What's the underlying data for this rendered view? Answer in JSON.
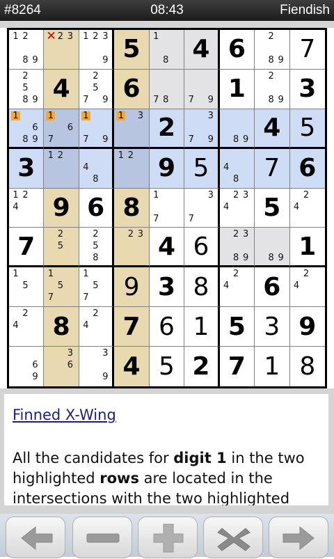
{
  "status_bar": {
    "puzzle_id": "#8264",
    "time": "08:43",
    "difficulty": "Fiendish"
  },
  "grid": [
    [
      {
        "c": [
          "1",
          "2",
          "8",
          "9"
        ]
      },
      {
        "c": [
          "1",
          "2",
          "3"
        ],
        "x": "1"
      },
      {
        "c": [
          "1",
          "2",
          "3",
          "9"
        ]
      },
      {
        "v": "5",
        "g": true
      },
      {
        "c": [
          "1",
          "8"
        ]
      },
      {
        "v": "4",
        "g": true
      },
      {
        "v": "6",
        "g": true
      },
      {
        "c": [
          "2",
          "8",
          "9"
        ]
      },
      {
        "v": "7",
        "g": false
      }
    ],
    [
      {
        "c": [
          "2",
          "5",
          "8",
          "9"
        ]
      },
      {
        "v": "4",
        "g": true
      },
      {
        "c": [
          "2",
          "5",
          "7",
          "9"
        ]
      },
      {
        "v": "6",
        "g": true
      },
      {
        "c": [
          "7",
          "8"
        ]
      },
      {
        "c": [
          "7",
          "9"
        ]
      },
      {
        "v": "1",
        "g": true
      },
      {
        "c": [
          "2",
          "8",
          "9"
        ]
      },
      {
        "v": "3",
        "g": true
      }
    ],
    [
      {
        "c": [
          "1",
          "6",
          "8",
          "9"
        ],
        "h": "1"
      },
      {
        "c": [
          "1",
          "6",
          "7"
        ],
        "h": "1"
      },
      {
        "c": [
          "1",
          "7",
          "9"
        ],
        "h": "1"
      },
      {
        "c": [
          "1",
          "3"
        ],
        "h": "1"
      },
      {
        "v": "2",
        "g": true
      },
      {
        "c": [
          "3",
          "7",
          "9"
        ]
      },
      {
        "c": [
          "8",
          "9"
        ]
      },
      {
        "v": "4",
        "g": true
      },
      {
        "v": "5",
        "g": false
      }
    ],
    [
      {
        "v": "3",
        "g": true
      },
      {
        "c": [
          "1",
          "2"
        ]
      },
      {
        "c": [
          "4",
          "8"
        ]
      },
      {
        "c": [
          "1",
          "2"
        ]
      },
      {
        "v": "9",
        "g": true
      },
      {
        "v": "5",
        "g": false
      },
      {
        "c": [
          "4",
          "8"
        ]
      },
      {
        "v": "7",
        "g": false
      },
      {
        "v": "6",
        "g": true
      }
    ],
    [
      {
        "c": [
          "1",
          "2",
          "4"
        ]
      },
      {
        "v": "9",
        "g": true
      },
      {
        "v": "6",
        "g": true
      },
      {
        "v": "8",
        "g": true
      },
      {
        "c": [
          "1",
          "7"
        ]
      },
      {
        "c": [
          "3",
          "7"
        ]
      },
      {
        "c": [
          "2",
          "3",
          "4"
        ]
      },
      {
        "v": "5",
        "g": true
      },
      {
        "c": [
          "2",
          "4"
        ]
      }
    ],
    [
      {
        "v": "7",
        "g": true
      },
      {
        "c": [
          "2",
          "5"
        ]
      },
      {
        "c": [
          "2",
          "5",
          "8"
        ]
      },
      {
        "c": [
          "2",
          "3"
        ]
      },
      {
        "v": "4",
        "g": true
      },
      {
        "v": "6",
        "g": false
      },
      {
        "c": [
          "2",
          "3",
          "8",
          "9"
        ]
      },
      {
        "c": [
          "8",
          "9"
        ]
      },
      {
        "v": "1",
        "g": true
      }
    ],
    [
      {
        "c": [
          "1",
          "5"
        ]
      },
      {
        "c": [
          "1",
          "5",
          "7"
        ]
      },
      {
        "c": [
          "1",
          "5",
          "7"
        ]
      },
      {
        "v": "9",
        "g": false
      },
      {
        "v": "3",
        "g": true
      },
      {
        "v": "8",
        "g": false
      },
      {
        "c": [
          "2",
          "4"
        ]
      },
      {
        "v": "6",
        "g": true
      },
      {
        "c": [
          "2",
          "4"
        ]
      }
    ],
    [
      {
        "c": [
          "2",
          "4"
        ]
      },
      {
        "v": "8",
        "g": true
      },
      {
        "c": [
          "2",
          "4"
        ]
      },
      {
        "v": "7",
        "g": true
      },
      {
        "v": "6",
        "g": false
      },
      {
        "v": "1",
        "g": false
      },
      {
        "v": "5",
        "g": true
      },
      {
        "v": "3",
        "g": false
      },
      {
        "v": "9",
        "g": true
      }
    ],
    [
      {
        "c": [
          "6",
          "9"
        ]
      },
      {
        "c": [
          "3",
          "6"
        ]
      },
      {
        "c": [
          "3",
          "9"
        ]
      },
      {
        "v": "4",
        "g": true
      },
      {
        "v": "5",
        "g": false
      },
      {
        "v": "2",
        "g": true
      },
      {
        "v": "7",
        "g": true
      },
      {
        "v": "1",
        "g": false
      },
      {
        "v": "8",
        "g": false
      }
    ]
  ],
  "hint": {
    "title": "Finned X-Wing",
    "text_parts": [
      "All the candidates for ",
      "digit 1",
      " in the two highlighted ",
      "rows",
      " are located in the intersections with the two highlighted"
    ]
  },
  "toolbar": [
    {
      "icon": "arrow-left-icon"
    },
    {
      "icon": "minus-icon"
    },
    {
      "icon": "plus-icon"
    },
    {
      "icon": "x-icon"
    },
    {
      "icon": "arrow-right-icon"
    }
  ],
  "colors": {
    "highlight_column": "#e8d9b0",
    "highlight_row": "#cfdcf5",
    "intersection": "#b7c5e0",
    "candidate_marker": "#f0a840",
    "gray_cell": "#e3e3e6"
  }
}
